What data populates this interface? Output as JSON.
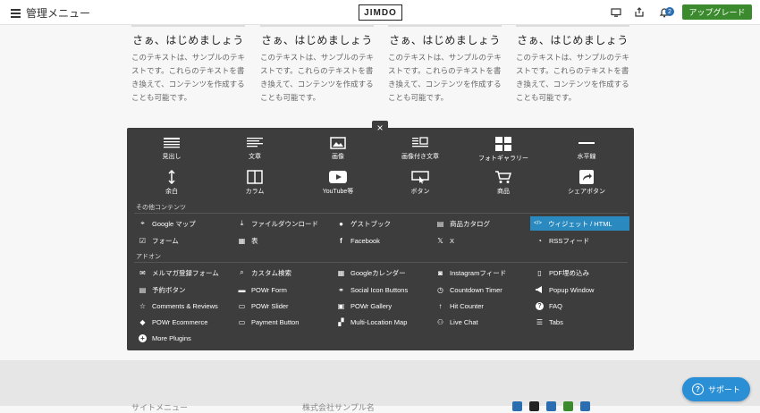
{
  "topbar": {
    "menu_label": "管理メニュー",
    "logo": "JIMDO",
    "notification_count": "2",
    "upgrade_label": "アップグレード"
  },
  "columns": [
    {
      "title": "さぁ、はじめましょう",
      "body": "このテキストは、サンプルのテキストです。これらのテキストを書き換えて、コンテンツを作成することも可能です。"
    },
    {
      "title": "さぁ、はじめましょう",
      "body": "このテキストは、サンプルのテキストです。これらのテキストを書き換えて、コンテンツを作成することも可能です。"
    },
    {
      "title": "さぁ、はじめましょう",
      "body": "このテキストは、サンプルのテキストです。これらのテキストを書き換えて、コンテンツを作成することも可能です。"
    },
    {
      "title": "さぁ、はじめましょう",
      "body": "このテキストは、サンプルのテキストです。これらのテキストを書き換えて、コンテンツを作成することも可能です。"
    }
  ],
  "panel": {
    "close": "×",
    "blocks": [
      {
        "label": "見出し",
        "icon": "heading-icon"
      },
      {
        "label": "文章",
        "icon": "text-icon"
      },
      {
        "label": "画像",
        "icon": "image-icon"
      },
      {
        "label": "画像付き文章",
        "icon": "image-text-icon"
      },
      {
        "label": "フォトギャラリー",
        "icon": "gallery-icon"
      },
      {
        "label": "水平線",
        "icon": "hr-icon"
      },
      {
        "label": "余白",
        "icon": "spacer-icon"
      },
      {
        "label": "カラム",
        "icon": "columns-icon"
      },
      {
        "label": "YouTube等",
        "icon": "youtube-icon"
      },
      {
        "label": "ボタン",
        "icon": "button-icon"
      },
      {
        "label": "商品",
        "icon": "cart-icon"
      },
      {
        "label": "シェアボタン",
        "icon": "share-icon"
      }
    ],
    "other_title": "その他コンテンツ",
    "other": [
      {
        "label": "Google マップ",
        "icon": "map-pin-icon",
        "glyph": "⌖"
      },
      {
        "label": "ファイルダウンロード",
        "icon": "download-icon",
        "glyph": "⤓"
      },
      {
        "label": "ゲストブック",
        "icon": "chat-icon",
        "glyph": "●"
      },
      {
        "label": "商品カタログ",
        "icon": "catalog-icon",
        "glyph": "▤"
      },
      {
        "label": "ウィジェット / HTML",
        "icon": "code-icon",
        "glyph": "</>"
      },
      {
        "label": "フォーム",
        "icon": "form-check-icon",
        "glyph": "☑"
      },
      {
        "label": "表",
        "icon": "table-icon",
        "glyph": "▦"
      },
      {
        "label": "Facebook",
        "icon": "facebook-icon",
        "glyph": "f"
      },
      {
        "label": "X",
        "icon": "x-icon",
        "glyph": "𝕏"
      },
      {
        "label": "RSSフィード",
        "icon": "rss-icon",
        "glyph": "◔"
      }
    ],
    "addon_title": "アドオン",
    "addons": [
      {
        "label": "メルマガ登録フォーム",
        "icon": "mail-icon",
        "glyph": "✉"
      },
      {
        "label": "カスタム検索",
        "icon": "search-icon",
        "glyph": "⌕"
      },
      {
        "label": "Googleカレンダー",
        "icon": "calendar-icon",
        "glyph": "▦"
      },
      {
        "label": "Instagramフィード",
        "icon": "instagram-icon",
        "glyph": "◙"
      },
      {
        "label": "PDF埋め込み",
        "icon": "pdf-icon",
        "glyph": "▯"
      },
      {
        "label": "予約ボタン",
        "icon": "booking-icon",
        "glyph": "▤"
      },
      {
        "label": "POWr Form",
        "icon": "powr-form-icon",
        "glyph": "▬"
      },
      {
        "label": "Social Icon Buttons",
        "icon": "link-icon",
        "glyph": "⚭"
      },
      {
        "label": "Countdown Timer",
        "icon": "clock-icon",
        "glyph": "◷"
      },
      {
        "label": "Popup Window",
        "icon": "megaphone-icon",
        "glyph": "📢"
      },
      {
        "label": "Comments & Reviews",
        "icon": "star-icon",
        "glyph": "☆"
      },
      {
        "label": "POWr Slider",
        "icon": "slider-icon",
        "glyph": "▭"
      },
      {
        "label": "POWr Gallery",
        "icon": "gallery-small-icon",
        "glyph": "▣"
      },
      {
        "label": "Hit Counter",
        "icon": "arrow-up-icon",
        "glyph": "↑"
      },
      {
        "label": "FAQ",
        "icon": "question-icon",
        "glyph": "?"
      },
      {
        "label": "POWr Ecommerce",
        "icon": "tag-icon",
        "glyph": "◆"
      },
      {
        "label": "Payment Button",
        "icon": "payment-icon",
        "glyph": "▭"
      },
      {
        "label": "Multi-Location Map",
        "icon": "map-icon",
        "glyph": "▞"
      },
      {
        "label": "Live Chat",
        "icon": "people-icon",
        "glyph": "⚇"
      },
      {
        "label": "Tabs",
        "icon": "tabs-icon",
        "glyph": "☰"
      },
      {
        "label": "More Plugins",
        "icon": "plus-circle-icon",
        "glyph": "+"
      }
    ]
  },
  "footer": {
    "site_menu": "サイトメニュー",
    "company": "株式会社サンプル名"
  },
  "support": {
    "label": "サポート",
    "icon": "question-circle-icon"
  },
  "colors": {
    "accent": "#2a8ac0",
    "upgrade": "#3b8b2e",
    "panel": "#3d3d3d",
    "support": "#2b8fd6"
  }
}
